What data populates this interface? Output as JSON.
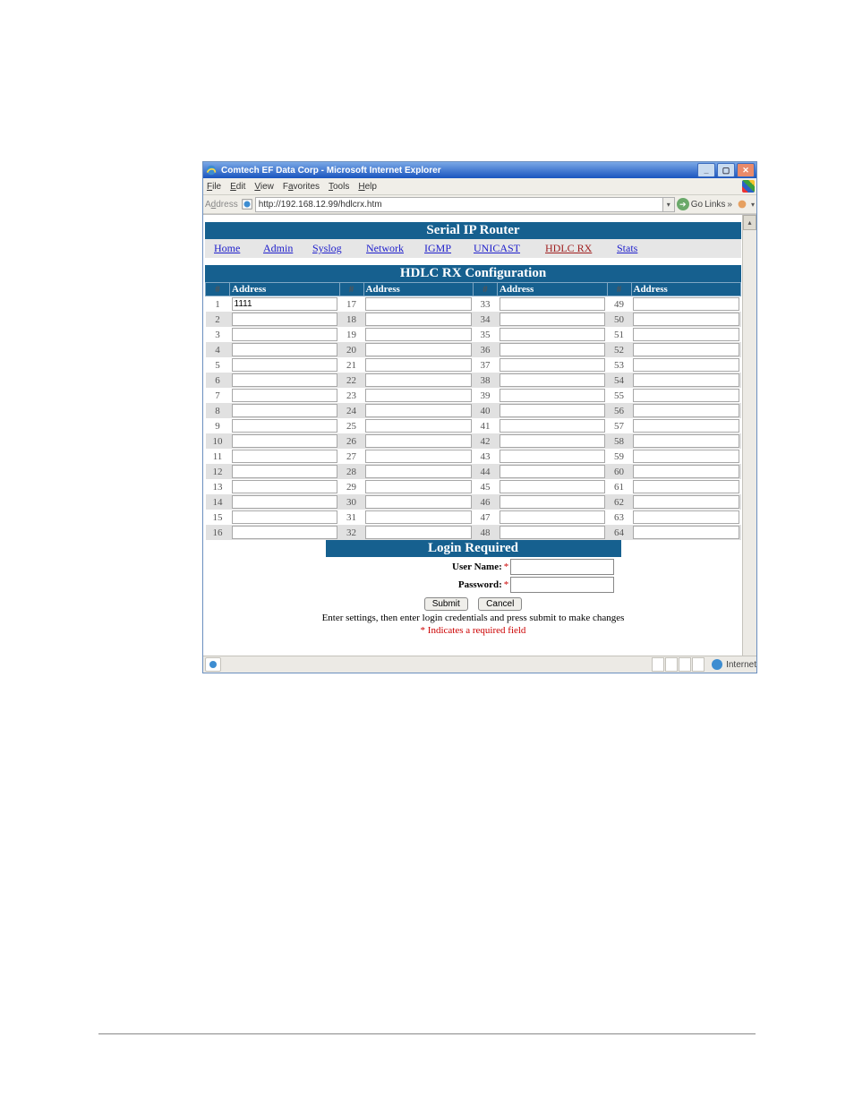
{
  "window": {
    "title": "Comtech EF Data Corp - Microsoft Internet Explorer",
    "menu": {
      "file": "File",
      "edit": "Edit",
      "view": "View",
      "favorites": "Favorites",
      "tools": "Tools",
      "help": "Help"
    },
    "addrbar": {
      "label": "Address",
      "url": "http://192.168.12.99/hdlcrx.htm",
      "go": "Go",
      "links": "Links"
    },
    "status": {
      "zone": "Internet"
    }
  },
  "banner": {
    "title": "Serial IP Router"
  },
  "nav": {
    "items": [
      "Home",
      "Admin",
      "Syslog",
      "Network",
      "IGMP",
      "UNICAST",
      "HDLC RX",
      "Stats"
    ],
    "active_index": 6
  },
  "section": {
    "title": "HDLC RX Configuration"
  },
  "table": {
    "header": "Address",
    "hash": "#",
    "columns": 4,
    "rows_per_column": 16,
    "total": 64,
    "values": {
      "1": "1111"
    }
  },
  "login": {
    "title": "Login Required",
    "user_label": "User Name:",
    "pass_label": "Password:",
    "star": "*",
    "submit": "Submit",
    "cancel": "Cancel",
    "note1": "Enter settings, then enter login credentials and press submit to make changes",
    "note2": "* Indicates a required field"
  }
}
